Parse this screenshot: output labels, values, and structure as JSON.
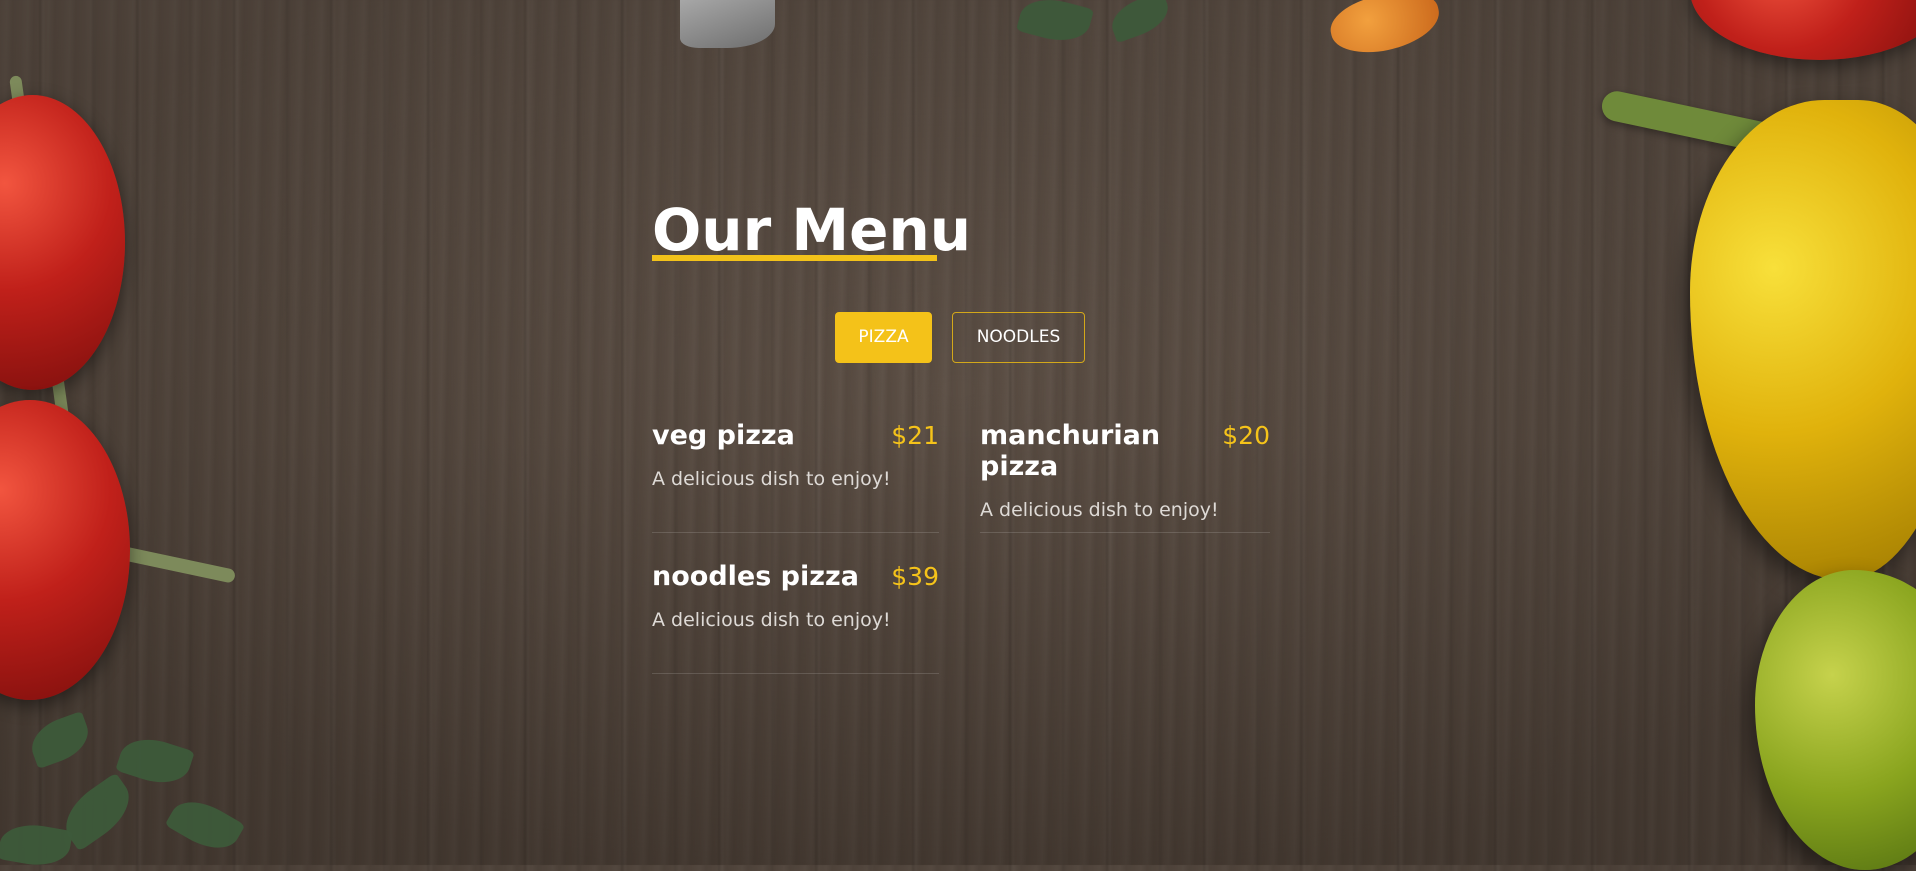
{
  "page": {
    "title": "Our Menu",
    "accent_color": "#f4c219"
  },
  "tabs": [
    {
      "label": "PIZZA",
      "active": true
    },
    {
      "label": "NOODLES",
      "active": false
    }
  ],
  "menu_items": [
    {
      "name": "veg pizza",
      "price": "$21",
      "description": "A delicious dish to enjoy!"
    },
    {
      "name": "manchurian pizza",
      "price": "$20",
      "description": "A delicious dish to enjoy!"
    },
    {
      "name": "noodles pizza",
      "price": "$39",
      "description": "A delicious dish to enjoy!"
    }
  ]
}
